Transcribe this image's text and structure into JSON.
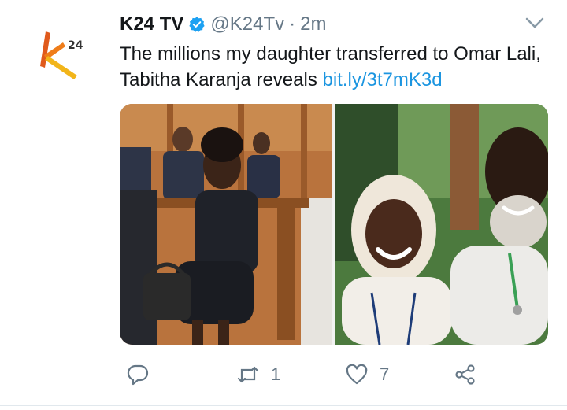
{
  "tweet": {
    "author_name": "K24 TV",
    "handle": "@K24Tv",
    "separator": "·",
    "time": "2m",
    "text": "The millions my daughter transferred to Omar Lali, Tabitha Karanja reveals ",
    "link": "bit.ly/3t7mK3d",
    "avatar_logo": "k24-logo",
    "verified_icon": "verified-badge-icon",
    "accent_color": "#1b95e0"
  },
  "actions": {
    "reply_icon": "reply-icon",
    "retweet_icon": "retweet-icon",
    "retweet_count": "1",
    "like_icon": "heart-icon",
    "like_count": "7",
    "share_icon": "share-icon"
  }
}
